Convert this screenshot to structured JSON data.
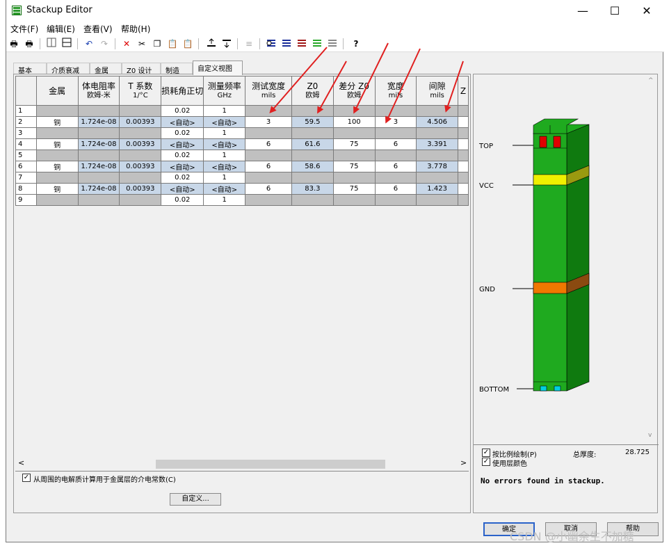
{
  "window": {
    "title": "Stackup Editor",
    "minimize": "—",
    "maximize": "☐",
    "close": "✕"
  },
  "menu": [
    "文件(F)",
    "编辑(E)",
    "查看(V)",
    "帮助(H)"
  ],
  "toolbar_icons": [
    "print-icon",
    "print-preview-icon",
    "split-vertical-icon",
    "split-horizontal-icon",
    "undo-icon",
    "redo-icon",
    "delete-icon",
    "cut-icon",
    "copy-icon",
    "paste-icon",
    "clipboard-icon",
    "insert-above-icon",
    "insert-below-icon",
    "move-layer-icon",
    "layer-type-1-icon",
    "layer-type-2-icon",
    "layer-type-3-icon",
    "layer-type-4-icon",
    "layer-type-5-icon",
    "help-icon"
  ],
  "tabs": [
    {
      "label": "基本",
      "active": false
    },
    {
      "label": "介质衰减",
      "active": false
    },
    {
      "label": "金属",
      "active": false
    },
    {
      "label": "Z0 设计",
      "active": false
    },
    {
      "label": "制造",
      "active": false
    },
    {
      "label": "自定义视图",
      "active": true
    }
  ],
  "grid": {
    "headers": [
      {
        "main": "",
        "sub": ""
      },
      {
        "main": "金属",
        "sub": ""
      },
      {
        "main": "体电阻率",
        "sub": "欧姆-米"
      },
      {
        "main": "T 系数",
        "sub": "1/°C"
      },
      {
        "main": "损耗角正切",
        "sub": ""
      },
      {
        "main": "测量频率",
        "sub": "GHz"
      },
      {
        "main": "测试宽度",
        "sub": "mils"
      },
      {
        "main": "Z0",
        "sub": "欧姆"
      },
      {
        "main": "差分 Z0",
        "sub": "欧姆"
      },
      {
        "main": "宽度",
        "sub": "mils"
      },
      {
        "main": "间隙",
        "sub": "mils"
      },
      {
        "main": "Z",
        "sub": ""
      }
    ],
    "rows": [
      {
        "n": "1",
        "kind": "diel",
        "loss": "0.02",
        "freq": "1"
      },
      {
        "n": "2",
        "kind": "metal",
        "metal": "铜",
        "res": "1.724e-08",
        "tc": "0.00393",
        "loss": "<自动>",
        "freq": "<自动>",
        "tw": "3",
        "z0": "59.5",
        "dz0": "100",
        "w": "3",
        "gap": "4.506"
      },
      {
        "n": "3",
        "kind": "diel",
        "loss": "0.02",
        "freq": "1"
      },
      {
        "n": "4",
        "kind": "metal",
        "metal": "铜",
        "res": "1.724e-08",
        "tc": "0.00393",
        "loss": "<自动>",
        "freq": "<自动>",
        "tw": "6",
        "z0": "61.6",
        "dz0": "75",
        "w": "6",
        "gap": "3.391"
      },
      {
        "n": "5",
        "kind": "diel",
        "loss": "0.02",
        "freq": "1"
      },
      {
        "n": "6",
        "kind": "metal",
        "metal": "铜",
        "res": "1.724e-08",
        "tc": "0.00393",
        "loss": "<自动>",
        "freq": "<自动>",
        "tw": "6",
        "z0": "58.6",
        "dz0": "75",
        "w": "6",
        "gap": "3.778"
      },
      {
        "n": "7",
        "kind": "diel",
        "loss": "0.02",
        "freq": "1"
      },
      {
        "n": "8",
        "kind": "metal",
        "metal": "铜",
        "res": "1.724e-08",
        "tc": "0.00393",
        "loss": "<自动>",
        "freq": "<自动>",
        "tw": "6",
        "z0": "83.3",
        "dz0": "75",
        "w": "6",
        "gap": "1.423"
      },
      {
        "n": "9",
        "kind": "diel",
        "loss": "0.02",
        "freq": "1"
      }
    ]
  },
  "scroll": {
    "left": "<",
    "right": ">",
    "up": "^",
    "down": "v"
  },
  "options": {
    "compute_dielectric": "从周围的电解质计算用于金属层的介电常数(C)",
    "custom_button": "自定义..."
  },
  "stackup_view": {
    "layers": [
      "TOP",
      "VCC",
      "GND",
      "BOTTOM"
    ],
    "colors": {
      "dielectric": "#1faa1f",
      "dielectric_dark": "#0f7a0f",
      "top_pad": "#e00000",
      "vcc": "#f0f000",
      "gnd": "#f07800",
      "bottom_pad": "#00d0e0"
    }
  },
  "right_options": {
    "scale_draw": "按比例绘制(P)",
    "use_layer_colors": "使用层颜色",
    "total_thickness_label": "总厚度:",
    "total_thickness_value": "28.725",
    "status": "No errors found in stackup."
  },
  "buttons": {
    "ok": "确定",
    "cancel": "取消",
    "help": "帮助"
  },
  "watermark": "CSDN @小幽余生不加糖",
  "annotation_color": "#e02020"
}
